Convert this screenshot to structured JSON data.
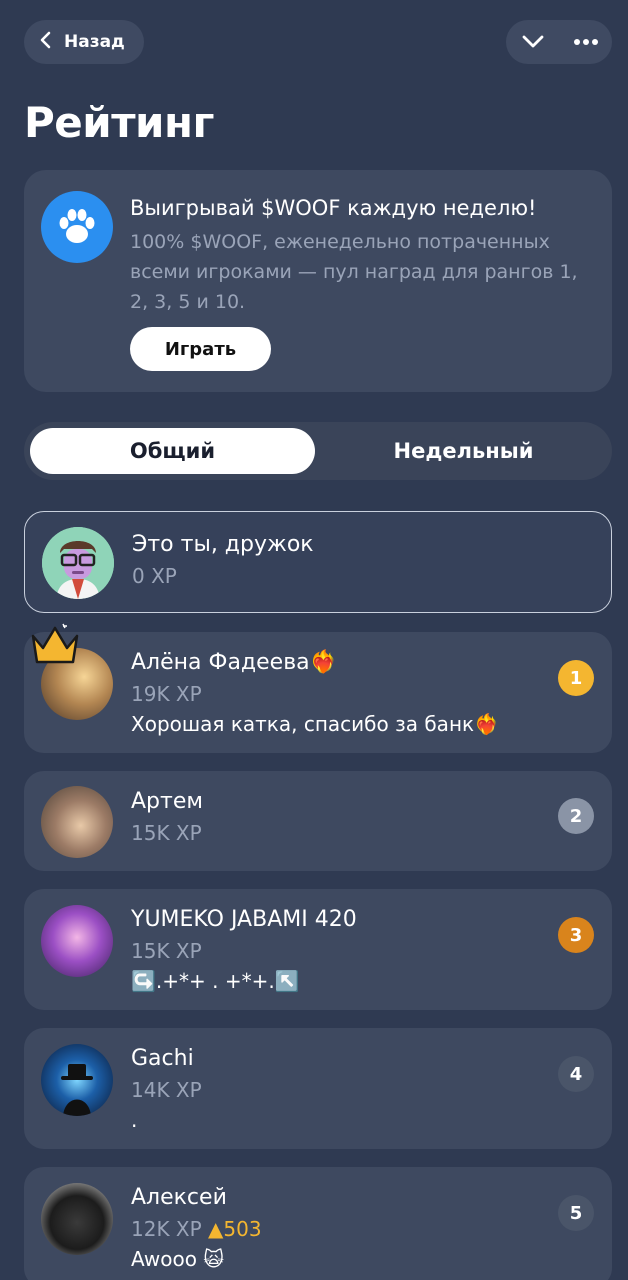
{
  "header": {
    "back_label": "Назад"
  },
  "page_title": "Рейтинг",
  "promo": {
    "title": "Выигрывай $WOOF каждую неделю!",
    "description": "100% $WOOF, еженедельно потраченных всеми игроками — пул наград для рангов 1, 2, 3, 5 и 10.",
    "button_label": "Играть"
  },
  "tabs": [
    {
      "label": "Общий",
      "active": true
    },
    {
      "label": "Недельный",
      "active": false
    }
  ],
  "me": {
    "name": "Это ты, дружок",
    "xp": "0 XP"
  },
  "leaderboard": [
    {
      "name": "Алёна Фадеева❤️‍🔥",
      "xp": "19K XP",
      "status": "Хорошая катка, спасибо за банк❤️‍🔥",
      "rank": "1",
      "rank_color": "#f4b630"
    },
    {
      "name": "Артем",
      "xp": "15K XP",
      "status": "",
      "rank": "2",
      "rank_color": "#8a94a6"
    },
    {
      "name": "YUMEKO JABAMI 420",
      "xp": "15K XP",
      "status": "↪️.+*+ . +*+.↖️",
      "rank": "3",
      "rank_color": "#d9841c"
    },
    {
      "name": "Gachi",
      "xp": "14K XP",
      "status": ".",
      "rank": "4",
      "rank_color": "#4a5569"
    },
    {
      "name": "Алексей",
      "xp": "12K XP",
      "xp_delta": "▲503",
      "status": "Awooo 🙀",
      "rank": "5",
      "rank_color": "#4a5569"
    }
  ],
  "colors": {
    "background": "#2f3a52",
    "card": "#3e4960",
    "accent_blue": "#2b8ff0",
    "gold": "#f4b630"
  }
}
